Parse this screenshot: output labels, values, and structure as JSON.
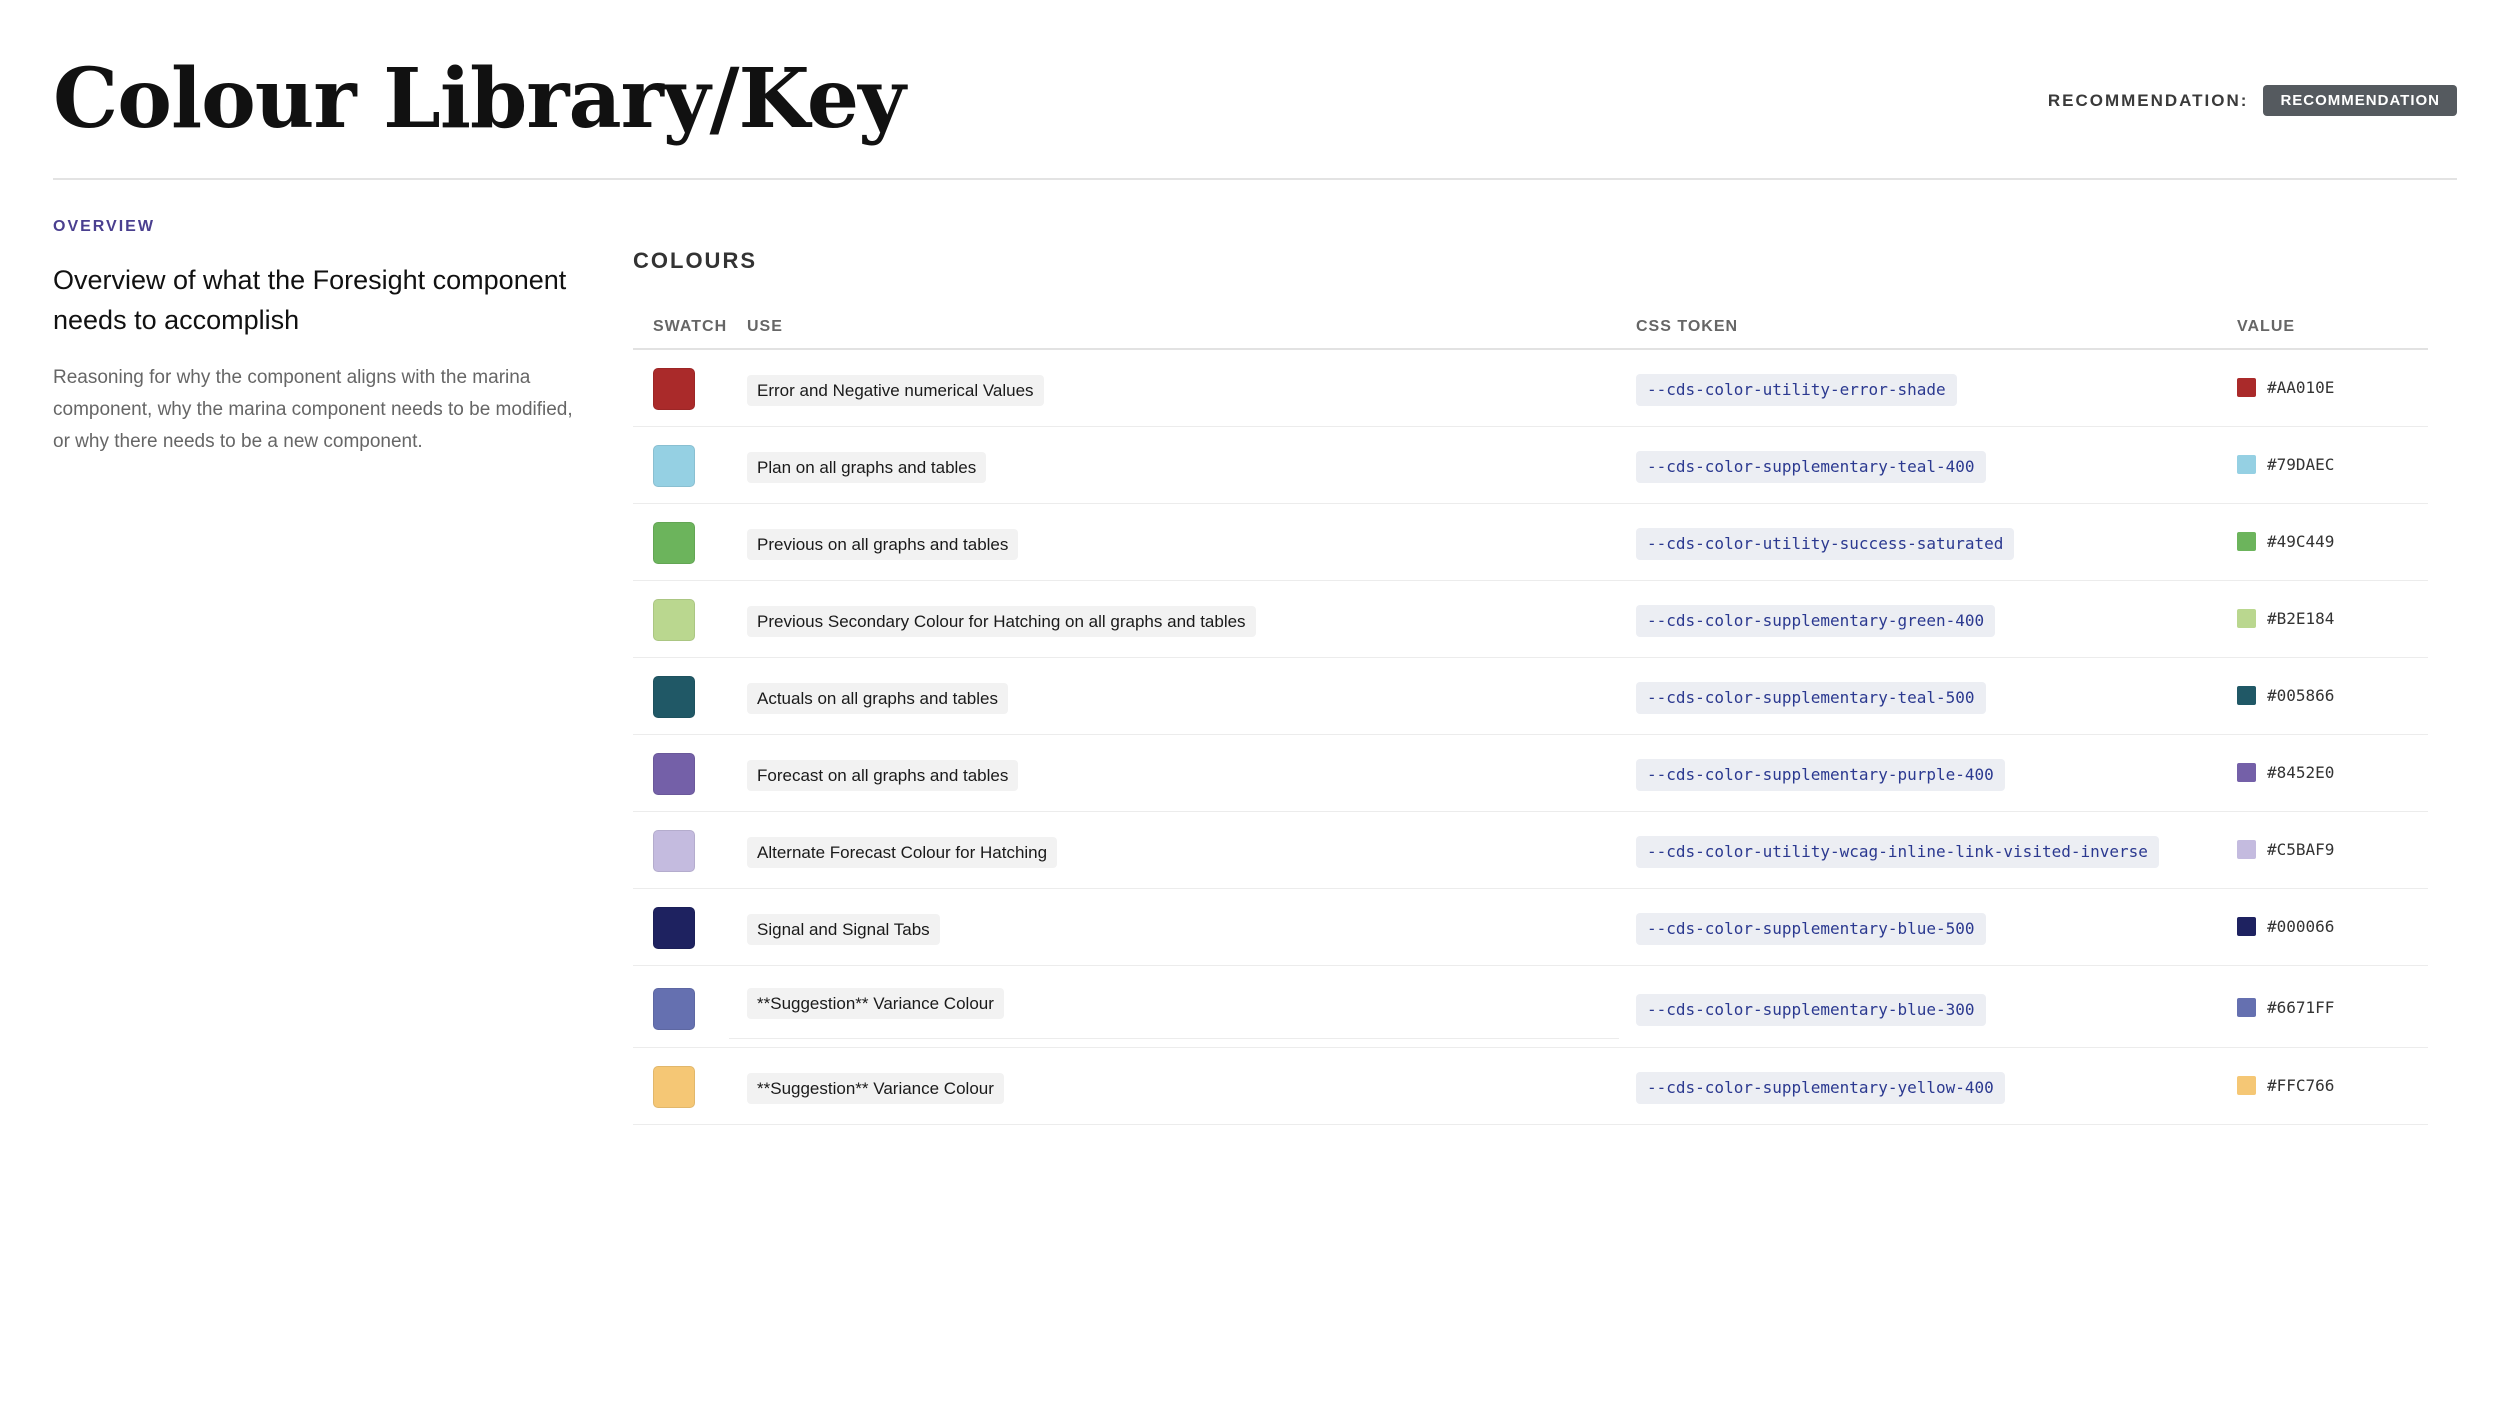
{
  "header": {
    "title": "Colour Library/Key",
    "recommendation_label": "RECOMMENDATION:",
    "recommendation_badge": "RECOMMENDATION"
  },
  "overview": {
    "kicker": "OVERVIEW",
    "heading": "Overview of what the Foresight component needs to accomplish",
    "body": "Reasoning for why the component aligns with the marina component, why the marina component needs to be modified, or why there needs to be a new component."
  },
  "colours": {
    "title": "COLOURS",
    "columns": {
      "swatch": "SWATCH",
      "use": "USE",
      "token": "CSS TOKEN",
      "value": "VALUE"
    },
    "rows": [
      {
        "use": "Error and Negative numerical Values",
        "token": "--cds-color-utility-error-shade",
        "value": "#AA010E",
        "color": "#AA2A2A"
      },
      {
        "use": "Plan on all graphs and tables",
        "token": "--cds-color-supplementary-teal-400",
        "value": "#79DAEC",
        "color": "#95D0E3"
      },
      {
        "use": "Previous on all graphs and tables",
        "token": "--cds-color-utility-success-saturated",
        "value": "#49C449",
        "color": "#6CB45C"
      },
      {
        "use": "Previous Secondary Colour for Hatching on all graphs and tables",
        "token": "--cds-color-supplementary-green-400",
        "value": "#B2E184",
        "color": "#BAD78F"
      },
      {
        "use": "Actuals on all graphs and tables",
        "token": "--cds-color-supplementary-teal-500",
        "value": "#005866",
        "color": "#205866"
      },
      {
        "use": "Forecast on all graphs and tables",
        "token": "--cds-color-supplementary-purple-400",
        "value": "#8452E0",
        "color": "#7460A8"
      },
      {
        "use": "Alternate Forecast Colour for Hatching",
        "token": "--cds-color-utility-wcag-inline-link-visited-inverse",
        "value": "#C5BAF9",
        "color": "#C4BBDF"
      },
      {
        "use": "Signal and Signal Tabs",
        "token": "--cds-color-supplementary-blue-500",
        "value": "#000066",
        "color": "#1E2260"
      },
      {
        "use": "**Suggestion** Variance Colour",
        "token": "--cds-color-supplementary-blue-300",
        "value": "#6671FF",
        "color": "#6570B0"
      },
      {
        "use": "**Suggestion** Variance Colour",
        "token": "--cds-color-supplementary-yellow-400",
        "value": "#FFC766",
        "color": "#F5C775"
      }
    ]
  }
}
